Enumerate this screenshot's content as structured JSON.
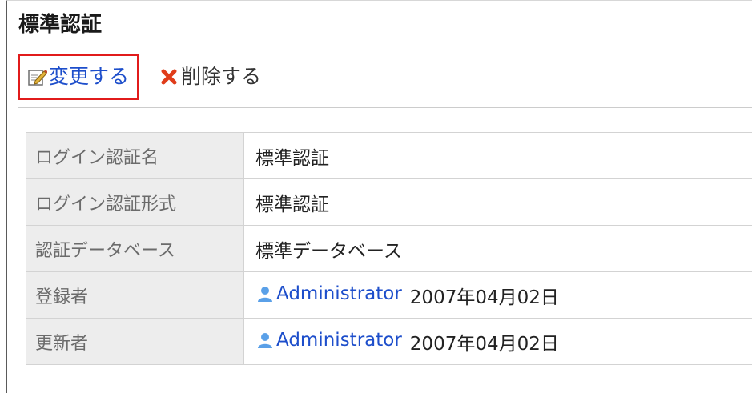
{
  "page": {
    "title": "標準認証"
  },
  "toolbar": {
    "edit_label": "変更する",
    "edit_icon": "edit-icon",
    "delete_label": "削除する",
    "delete_icon": "delete-x-icon"
  },
  "details": {
    "rows": [
      {
        "label": "ログイン認証名",
        "value": "標準認証"
      },
      {
        "label": "ログイン認証形式",
        "value": "標準認証"
      },
      {
        "label": "認証データベース",
        "value": "標準データベース"
      },
      {
        "label": "登録者",
        "user": "Administrator",
        "user_icon": "user-icon",
        "date": "2007年04月02日"
      },
      {
        "label": "更新者",
        "user": "Administrator",
        "user_icon": "user-icon",
        "date": "2007年04月02日"
      }
    ]
  },
  "colors": {
    "link": "#1d4ecb",
    "highlight_border": "#e11b1b",
    "delete_icon": "#e03c1a",
    "user_icon": "#5aa0e8",
    "label_cell_bg": "#ededed"
  }
}
